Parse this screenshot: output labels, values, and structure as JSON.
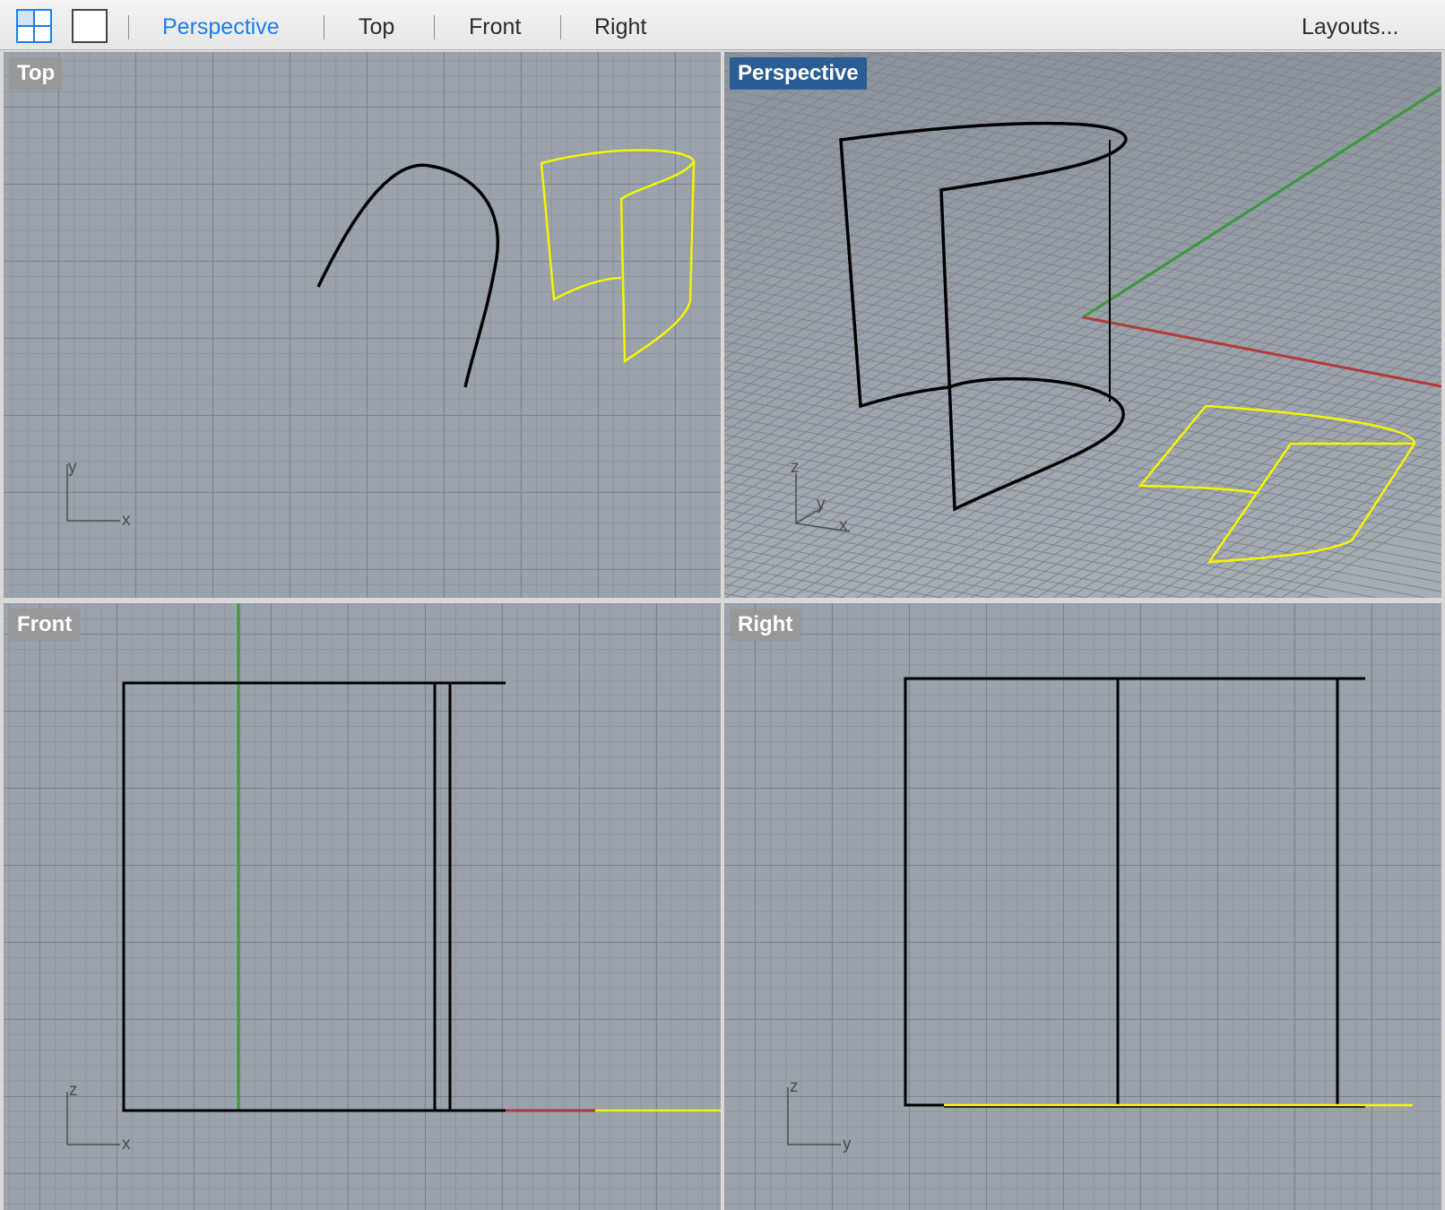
{
  "toolbar": {
    "tabs": [
      "Perspective",
      "Top",
      "Front",
      "Right"
    ],
    "active_tab": "Perspective",
    "layouts_label": "Layouts...",
    "icons": [
      "four-viewport-layout-icon",
      "single-viewport-icon"
    ]
  },
  "viewports": {
    "top": {
      "label": "Top",
      "axes": [
        "y",
        "x"
      ]
    },
    "perspective": {
      "label": "Perspective",
      "axes": [
        "z",
        "y",
        "x"
      ]
    },
    "front": {
      "label": "Front",
      "axes": [
        "z",
        "x"
      ]
    },
    "right": {
      "label": "Right",
      "axes": [
        "z",
        "y"
      ]
    }
  },
  "colors": {
    "active_tab": "#1a7ff0",
    "active_viewport_label": "#2a5d94",
    "selected_object": "#f5f500",
    "curve": "#000000",
    "x_axis": "#b23a3a",
    "y_axis": "#3c9a3c",
    "viewport_background": "#9aa2ab",
    "grid": "#7c848d"
  }
}
